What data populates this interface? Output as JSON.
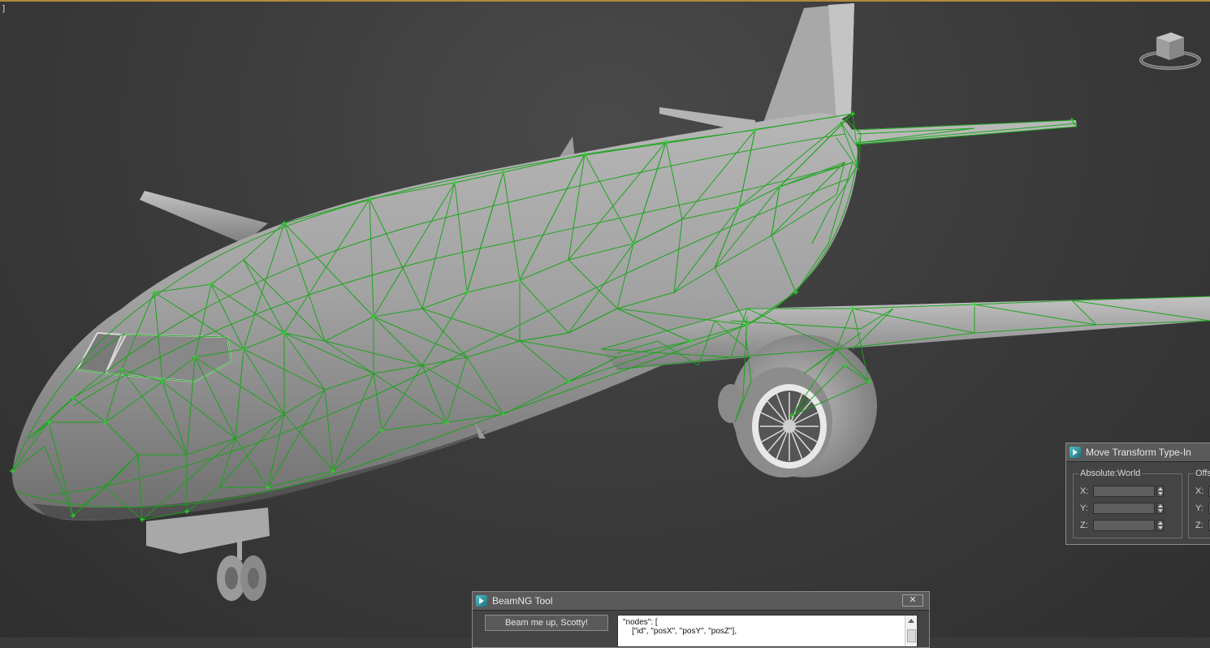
{
  "viewport": {
    "label": "]",
    "viewcube_icon": "viewcube-icon",
    "colors": {
      "wireframe": "#1aa01a",
      "model": "#9a9a9a",
      "background": "#3a3a3a"
    }
  },
  "move_transform": {
    "title": "Move Transform Type-In",
    "absolute_label": "Absolute:World",
    "offset_label": "Offs",
    "axes": [
      "X:",
      "Y:",
      "Z:"
    ]
  },
  "beamng_tool": {
    "title": "BeamNG Tool",
    "close_icon": "close-icon",
    "beam_button_label": "Beam me up, Scotty!",
    "json_line1": "\"nodes\": [",
    "json_line2": "    [\"id\", \"posX\", \"posY\", \"posZ\"],"
  }
}
